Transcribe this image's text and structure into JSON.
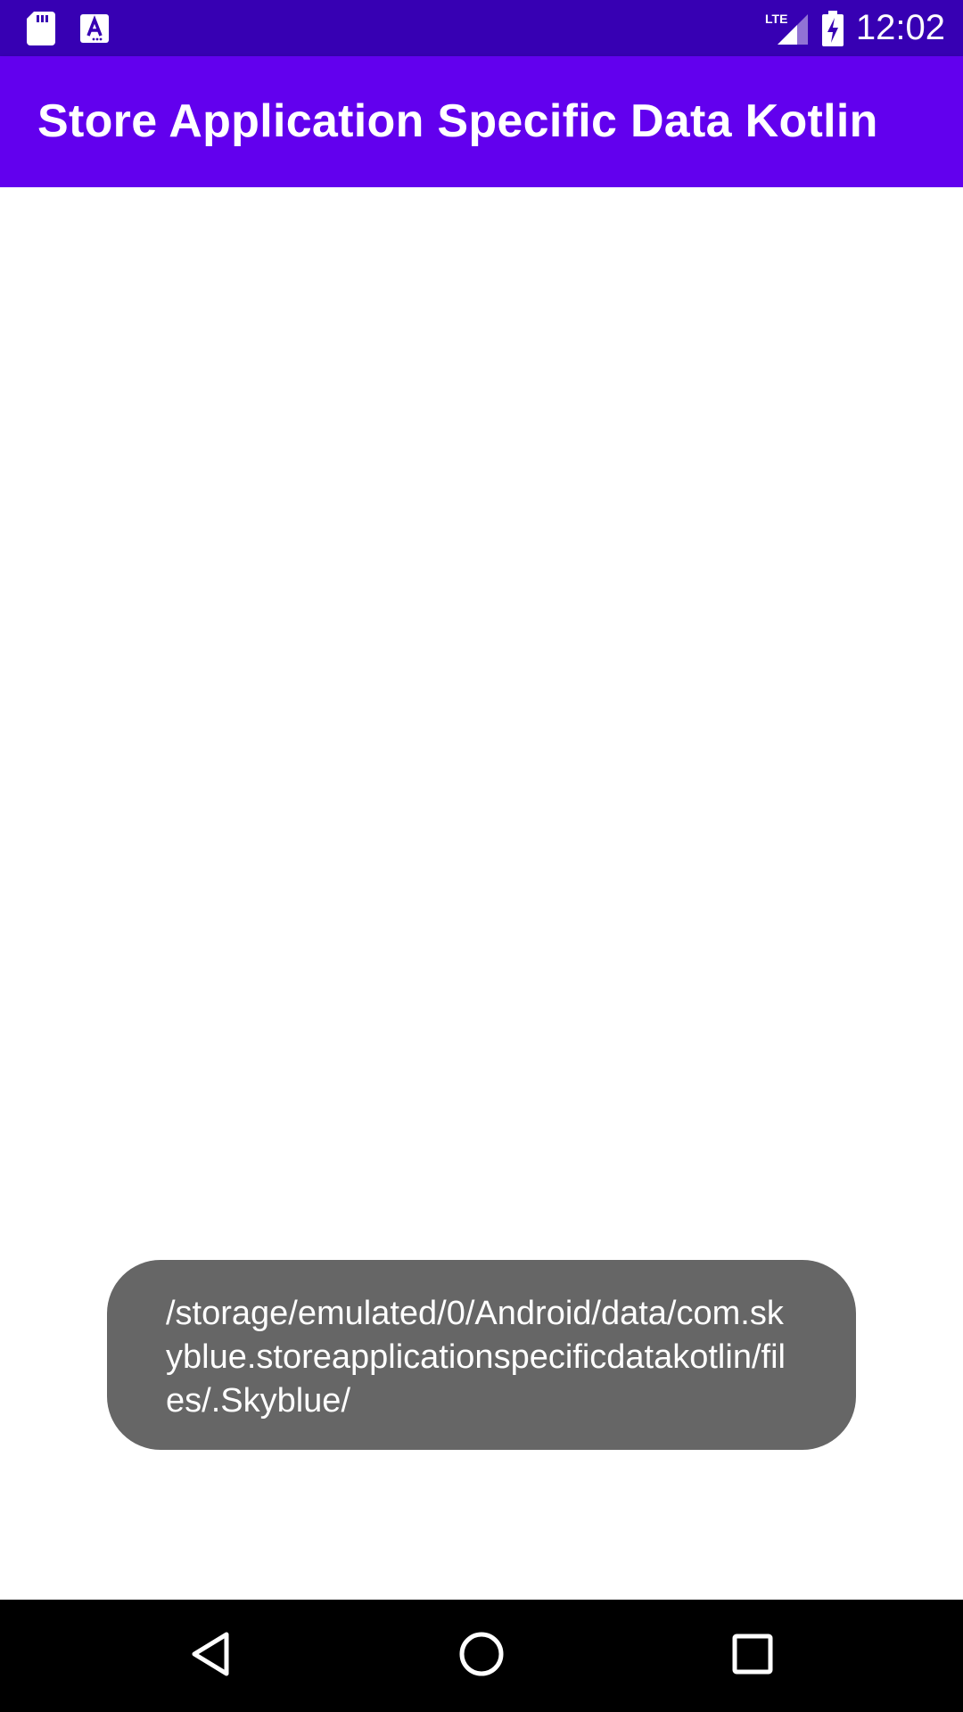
{
  "status_bar": {
    "time": "12:02",
    "network_label": "LTE",
    "colors": {
      "background": "#3700b3"
    },
    "icons": [
      "sd-card-icon",
      "text-accessibility-icon",
      "lte-signal-icon",
      "battery-charging-icon"
    ]
  },
  "app_bar": {
    "title": "Store Application Specific Data Kotlin",
    "colors": {
      "background": "#6200ee",
      "text": "#ffffff"
    }
  },
  "toast": {
    "message": "/storage/emulated/0/Android/data/com.skyblue.storeapplicationspecificdatakotlin/files/.Skyblue/",
    "colors": {
      "background": "#666666",
      "text": "#ffffff"
    }
  },
  "nav_bar": {
    "buttons": [
      "back-icon",
      "home-icon",
      "recents-icon"
    ],
    "colors": {
      "background": "#000000"
    }
  }
}
